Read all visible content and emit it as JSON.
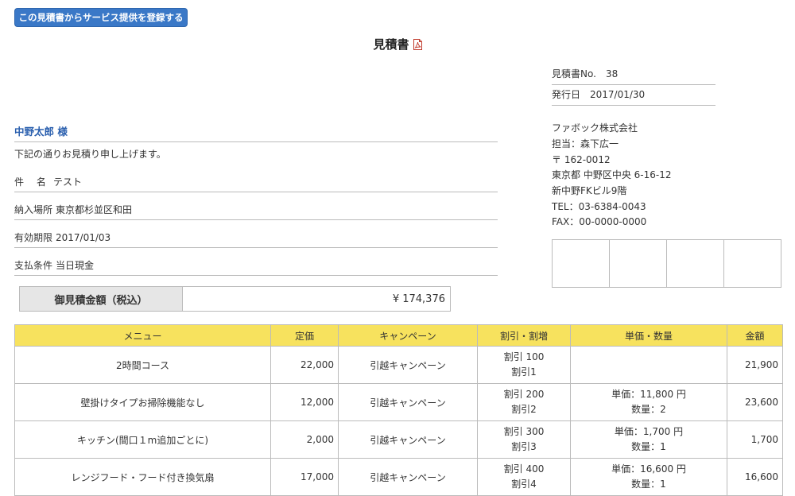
{
  "register_button": "この見積書からサービス提供を登録する",
  "doc_title": "見積書",
  "meta": {
    "number_label": "見積書No.",
    "number_value": "38",
    "date_label": "発行日",
    "date_value": "2017/01/30"
  },
  "company": {
    "name": "ファボック株式会社",
    "person": "担当：森下広一",
    "postal": "〒 162-0012",
    "address1": "東京都 中野区中央 6-16-12",
    "address2": "新中野FKビル9階",
    "tel": "TEL：03-6384-0043",
    "fax": "FAX：00-0000-0000"
  },
  "customer": "中野太郎 様",
  "intro": "下記の通りお見積り申し上げます。",
  "fields": [
    {
      "label": "件　 名",
      "value": "テスト"
    },
    {
      "label": "納入場所",
      "value": "東京都杉並区和田"
    },
    {
      "label": "有効期限",
      "value": "2017/01/03"
    },
    {
      "label": "支払条件",
      "value": "当日現金"
    }
  ],
  "total": {
    "label": "御見積金額（税込）",
    "value": "¥ 174,376"
  },
  "table": {
    "headers": [
      "メニュー",
      "定価",
      "キャンペーン",
      "割引・割増",
      "単価・数量",
      "金額"
    ],
    "rows": [
      {
        "menu": "2時間コース",
        "price": "22,000",
        "campaign": "引越キャンペーン",
        "disc1": "割引 100",
        "disc2": "割引1",
        "unit1": "",
        "unit2": "",
        "amount": "21,900"
      },
      {
        "menu": "壁掛けタイプお掃除機能なし",
        "price": "12,000",
        "campaign": "引越キャンペーン",
        "disc1": "割引 200",
        "disc2": "割引2",
        "unit1": "単価：11,800 円",
        "unit2": "数量：2",
        "amount": "23,600"
      },
      {
        "menu": "キッチン(間口１m追加ごとに)",
        "price": "2,000",
        "campaign": "引越キャンペーン",
        "disc1": "割引 300",
        "disc2": "割引3",
        "unit1": "単価：1,700 円",
        "unit2": "数量：1",
        "amount": "1,700"
      },
      {
        "menu": "レンジフード・フード付き換気扇",
        "price": "17,000",
        "campaign": "引越キャンペーン",
        "disc1": "割引 400",
        "disc2": "割引4",
        "unit1": "単価：16,600 円",
        "unit2": "数量：1",
        "amount": "16,600"
      }
    ]
  },
  "colors": {
    "button_bg": "#3a78c7",
    "customer_text": "#2a5fae",
    "table_header_bg": "#f7e25e",
    "total_label_bg": "#e6e6e6"
  },
  "icons": {
    "pdf": "pdf-icon"
  }
}
